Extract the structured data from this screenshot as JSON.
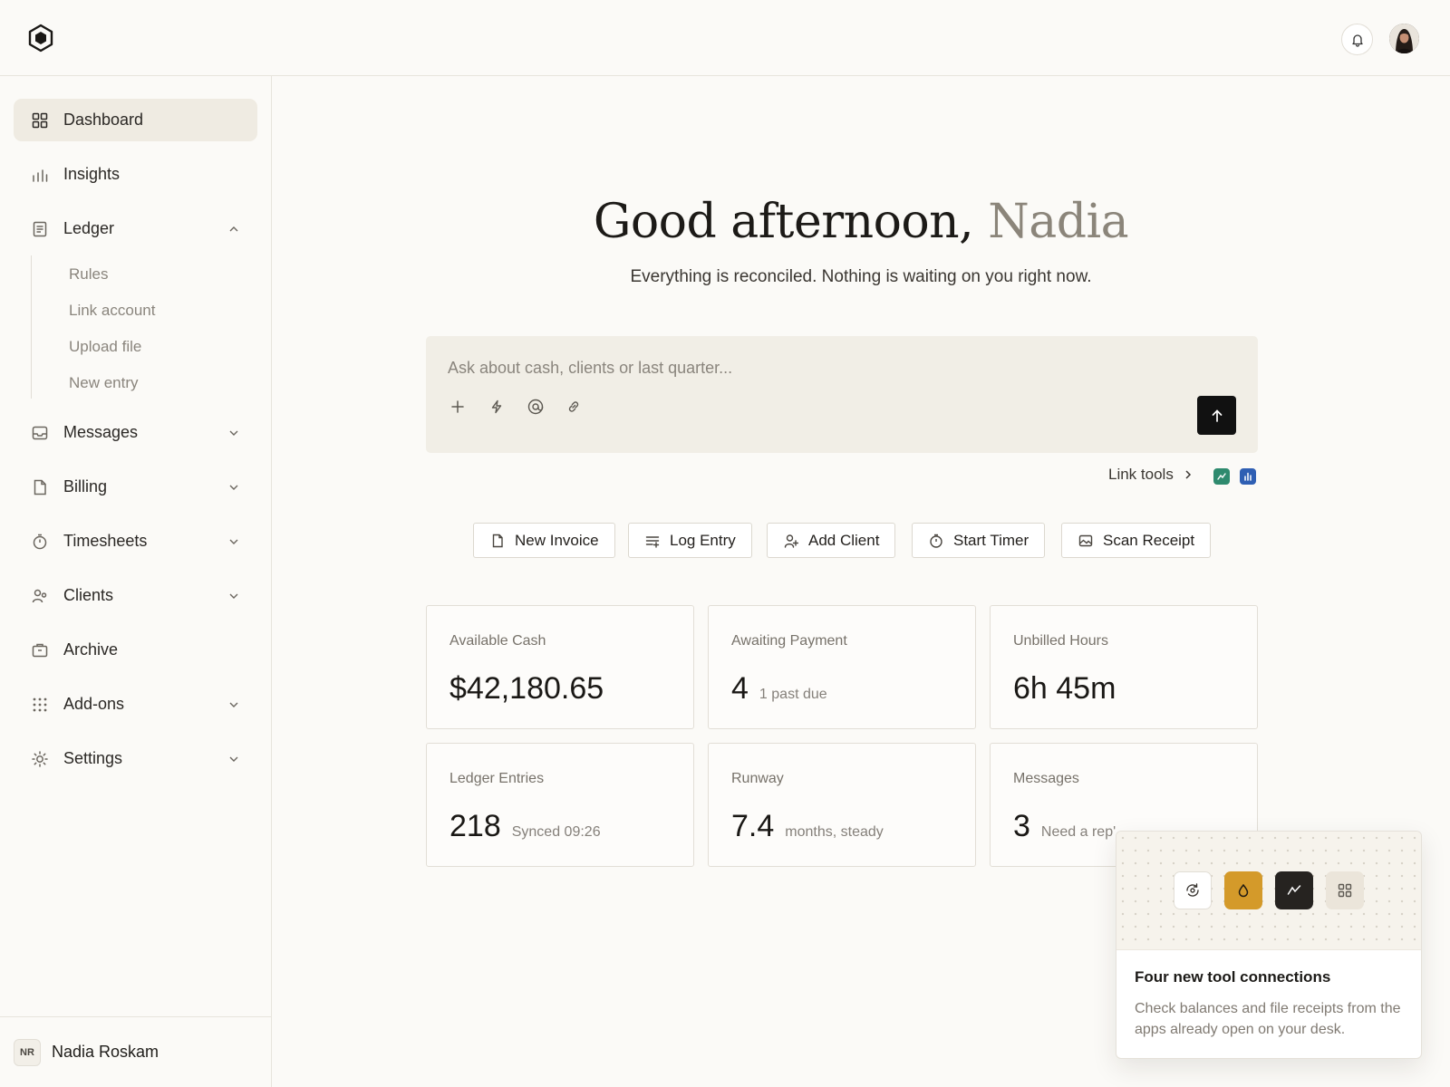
{
  "header": {
    "logo": "hexagon-logo",
    "notifications_icon": "bell-icon",
    "avatar": "user-avatar"
  },
  "sidebar": {
    "items": [
      {
        "label": "Dashboard",
        "icon": "grid-icon",
        "active": true
      },
      {
        "label": "Insights",
        "icon": "bar-chart-icon"
      },
      {
        "label": "Ledger",
        "icon": "document-icon",
        "expanded": true
      },
      {
        "label": "Messages",
        "icon": "inbox-icon"
      },
      {
        "label": "Billing",
        "icon": "file-icon"
      },
      {
        "label": "Timesheets",
        "icon": "timer-icon"
      },
      {
        "label": "Clients",
        "icon": "users-icon"
      },
      {
        "label": "Archive",
        "icon": "briefcase-icon"
      },
      {
        "label": "Add-ons",
        "icon": "dots-grid-icon"
      },
      {
        "label": "Settings",
        "icon": "sun-gear-icon"
      }
    ],
    "ledger_sub": [
      "Rules",
      "Link account",
      "Upload file",
      "New entry"
    ],
    "user": {
      "initials": "NR",
      "name": "Nadia Roskam"
    }
  },
  "main": {
    "greeting_prefix": "Good afternoon,",
    "greeting_name": "Nadia",
    "subtitle": "Everything is reconciled. Nothing is waiting on you right now.",
    "prompt": {
      "placeholder": "Ask about cash, clients or last quarter...",
      "tools": [
        "plus-icon",
        "lightning-icon",
        "at-icon",
        "link-icon"
      ],
      "send_icon": "arrow-up-icon"
    },
    "link_tools_label": "Link tools",
    "quick_actions": [
      {
        "label": "New Invoice",
        "icon": "file-icon"
      },
      {
        "label": "Log Entry",
        "icon": "list-add-icon"
      },
      {
        "label": "Add Client",
        "icon": "user-add-icon"
      },
      {
        "label": "Start Timer",
        "icon": "timer-icon"
      },
      {
        "label": "Scan Receipt",
        "icon": "image-icon"
      }
    ],
    "cards": [
      {
        "label": "Available Cash",
        "value": "$42,180.65",
        "note": ""
      },
      {
        "label": "Awaiting Payment",
        "value": "4",
        "note": "1 past due"
      },
      {
        "label": "Unbilled Hours",
        "value": "6h 45m",
        "note": ""
      },
      {
        "label": "Ledger Entries",
        "value": "218",
        "note": "Synced 09:26"
      },
      {
        "label": "Runway",
        "value": "7.4",
        "note": "months, steady"
      },
      {
        "label": "Messages",
        "value": "3",
        "note": "Need a rep'"
      }
    ]
  },
  "popover": {
    "title": "Four new tool connections",
    "description": "Check balances and file receipts from the apps already open on your desk.",
    "icons": [
      "sync-icon",
      "drop-icon",
      "trend-icon",
      "grid-icon"
    ]
  },
  "colors": {
    "background": "#fbfaf7",
    "active_nav": "#efebe2",
    "prompt_bg": "#f1eee6",
    "accent_gold": "#d49a2a",
    "dark": "#1c1a17"
  }
}
